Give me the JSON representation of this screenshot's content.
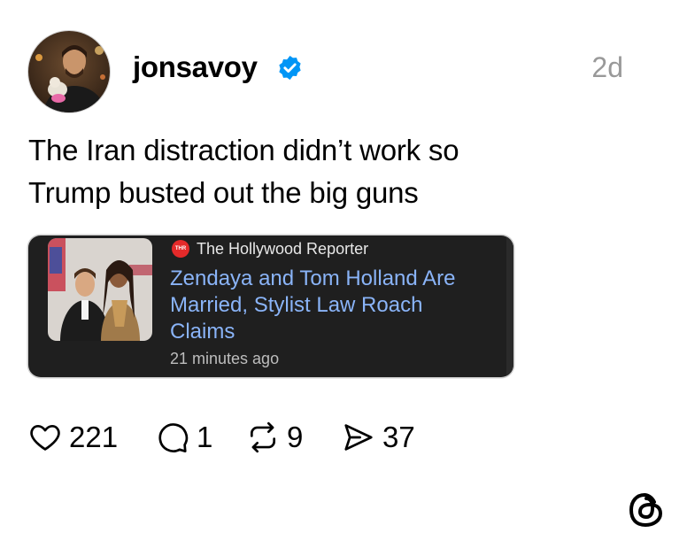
{
  "post": {
    "username": "jonsavoy",
    "verified": true,
    "timestamp": "2d",
    "text_lines": [
      "The Iran distraction didn’t work so",
      "Trump busted out the big guns"
    ]
  },
  "link_card": {
    "source": "The Hollywood Reporter",
    "source_logo_text": "THR",
    "headline_lines": [
      "Zendaya and Tom Holland Are",
      "Married, Stylist Law Roach",
      "Claims"
    ],
    "time": "21 minutes ago"
  },
  "actions": {
    "likes": "221",
    "replies": "1",
    "reposts": "9",
    "shares": "37"
  },
  "icons": {
    "verified": "verified-badge-icon",
    "like": "heart-icon",
    "reply": "comment-bubble-icon",
    "repost": "repost-icon",
    "share": "send-icon",
    "brand": "threads-logo-icon"
  },
  "colors": {
    "verified": "#0095f6",
    "link_headline": "#8ab4f8",
    "card_background": "#1f1f1f",
    "timestamp": "#999999"
  }
}
